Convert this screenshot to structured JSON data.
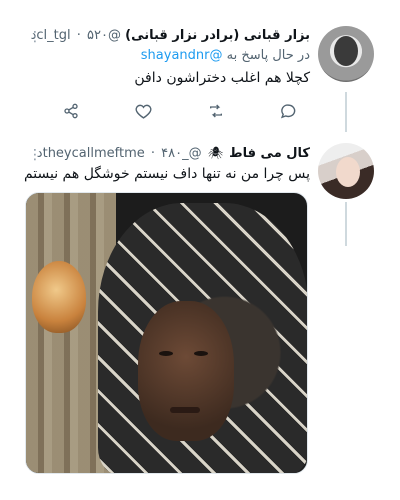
{
  "tweet_1": {
    "author_name": "بزار قبانی (برادر نزار قبانی)",
    "handle": "@cl_tgl",
    "time": "۵۲۰د",
    "replying_prefix": "در حال پاسخ به",
    "replying_to": "@shayandnr",
    "text": "کچلا هم اغلب دختراشون دافن",
    "actions": [
      "reply-icon",
      "retweet-icon",
      "like-icon",
      "share-icon"
    ]
  },
  "tweet_2": {
    "author_name": "کال می فاط",
    "author_emoji_icon": "bug-icon",
    "handle": "@_theycallmeftme",
    "time": "۴۸۰د",
    "text": "پس چرا من نه تنها داف نیستم خوشگل هم نیستم",
    "media_icon": "photo"
  },
  "colors": {
    "link": "#1d9bf0",
    "secondary_text": "#536471",
    "thread_line": "#cfd9de"
  }
}
